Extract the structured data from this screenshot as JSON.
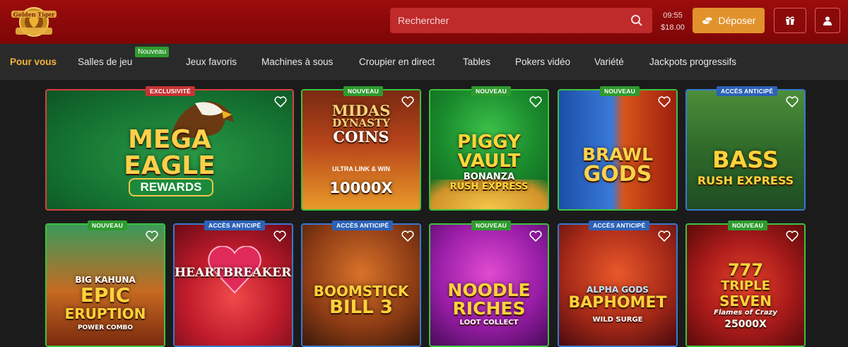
{
  "header": {
    "logo_text": "Golden Tiger",
    "search_placeholder": "Rechercher",
    "time": "09:55",
    "balance": "$18.00",
    "deposit_label": "Déposer",
    "colors": {
      "bar": "#8a0a0a",
      "deposit": "#e2922b",
      "search": "#bf2a2a"
    }
  },
  "nav": {
    "items": [
      {
        "label": "Pour vous"
      },
      {
        "label": "Salles de jeu",
        "badge": "Nouveau"
      },
      {
        "label": "Jeux favoris"
      },
      {
        "label": "Machines à sous"
      },
      {
        "label": "Croupier en direct"
      },
      {
        "label": "Tables"
      },
      {
        "label": "Pokers vidéo"
      },
      {
        "label": "Variété"
      },
      {
        "label": "Jackpots progressifs"
      }
    ],
    "active_color": "#f4b43c"
  },
  "games": [
    {
      "badge": "EXCLUSIVITÉ",
      "badge_color": "red",
      "title_lines": [
        "MEGA",
        "EAGLE"
      ],
      "subtitle": "REWARDS"
    },
    {
      "badge": "NOUVEAU",
      "badge_color": "green",
      "title_lines": [
        "MIDAS",
        "DYNASTY",
        "COINS"
      ],
      "subtitle": "ULTRA LINK & WIN",
      "extra": "10000X"
    },
    {
      "badge": "NOUVEAU",
      "badge_color": "green",
      "title_lines": [
        "PIGGY",
        "VAULT"
      ],
      "subtitle": "BONANZA",
      "extra": "RUSH EXPRESS"
    },
    {
      "badge": "NOUVEAU",
      "badge_color": "green",
      "title_lines": [
        "BRAWL",
        "GODS"
      ]
    },
    {
      "badge": "ACCÈS ANTICIPÉ",
      "badge_color": "blue",
      "title_lines": [
        "BASS"
      ],
      "subtitle": "RUSH EXPRESS"
    },
    {
      "badge": "NOUVEAU",
      "badge_color": "green",
      "title_lines": [
        "BIG KAHUNA",
        "EPIC",
        "ERUPTION"
      ],
      "subtitle": "POWER COMBO"
    },
    {
      "badge": "ACCÈS ANTICIPÉ",
      "badge_color": "blue",
      "title_lines": [
        "HEARTBREAKERS"
      ]
    },
    {
      "badge": "ACCÈS ANTICIPÉ",
      "badge_color": "blue",
      "title_lines": [
        "BOOMSTICK",
        "BILL 3"
      ]
    },
    {
      "badge": "NOUVEAU",
      "badge_color": "green",
      "title_lines": [
        "NOODLE",
        "RICHES"
      ],
      "subtitle": "LOOT COLLECT"
    },
    {
      "badge": "ACCÈS ANTICIPÉ",
      "badge_color": "blue",
      "title_lines": [
        "ALPHA GODS",
        "BAPHOMET"
      ],
      "subtitle": "WILD SURGE"
    },
    {
      "badge": "NOUVEAU",
      "badge_color": "green",
      "title_lines": [
        "777",
        "TRIPLE",
        "SEVEN"
      ],
      "subtitle": "Flames of Crazy",
      "extra": "25000X"
    }
  ]
}
